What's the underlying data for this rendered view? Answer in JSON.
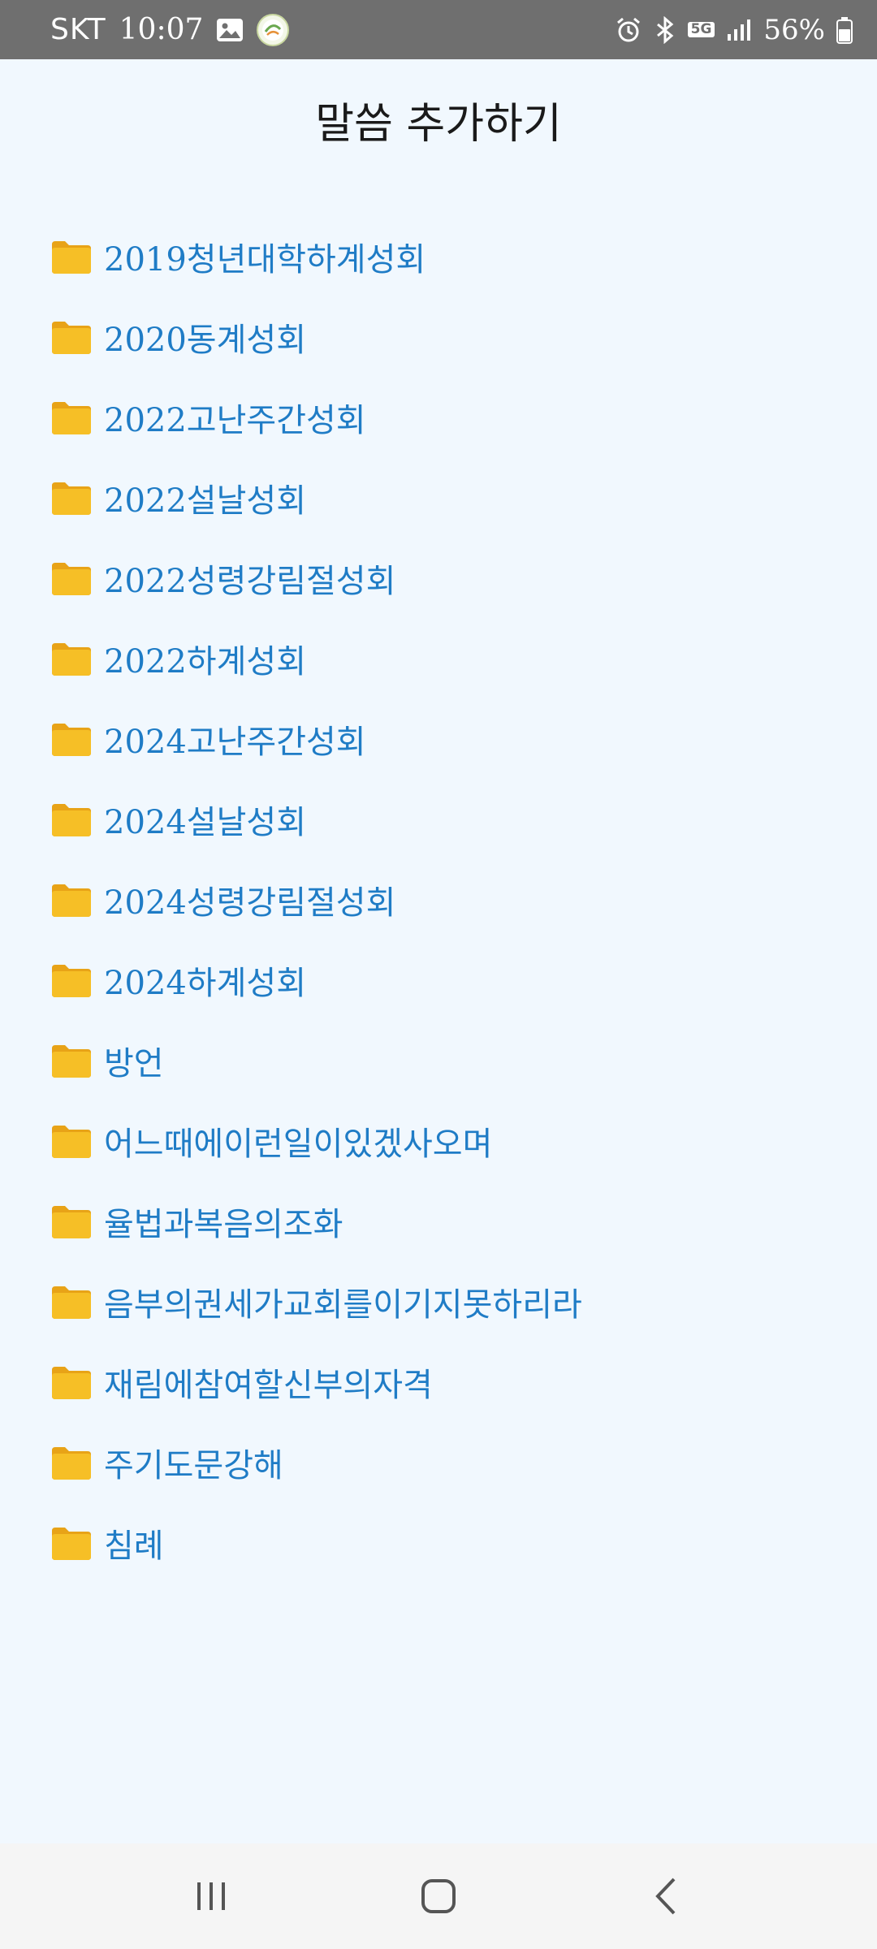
{
  "status_bar": {
    "carrier": "SKT",
    "time": "10:07",
    "network_badge": "5G",
    "battery": "56%",
    "icons": [
      "gallery-icon",
      "app-notification-icon",
      "alarm-icon",
      "bluetooth-icon",
      "5g-icon",
      "signal-icon",
      "battery-icon"
    ]
  },
  "page": {
    "title": "말씀 추가하기"
  },
  "folders": [
    "2019청년대학하계성회",
    "2020동계성회",
    "2022고난주간성회",
    "2022설날성회",
    "2022성령강림절성회",
    "2022하계성회",
    "2024고난주간성회",
    "2024설날성회",
    "2024성령강림절성회",
    "2024하계성회",
    "방언",
    "어느때에이런일이있겠사오며",
    "율법과복음의조화",
    "음부의권세가교회를이기지못하리라",
    "재림에참여할신부의자격",
    "주기도문강해",
    "침례"
  ],
  "colors": {
    "background": "#f1f8fe",
    "folder_label": "#1f7cc6",
    "folder_icon": "#f6bf26",
    "status_bar": "#6f6f6f"
  },
  "nav_bar": {
    "buttons": [
      "recent-apps-icon",
      "home-icon",
      "back-icon"
    ]
  }
}
